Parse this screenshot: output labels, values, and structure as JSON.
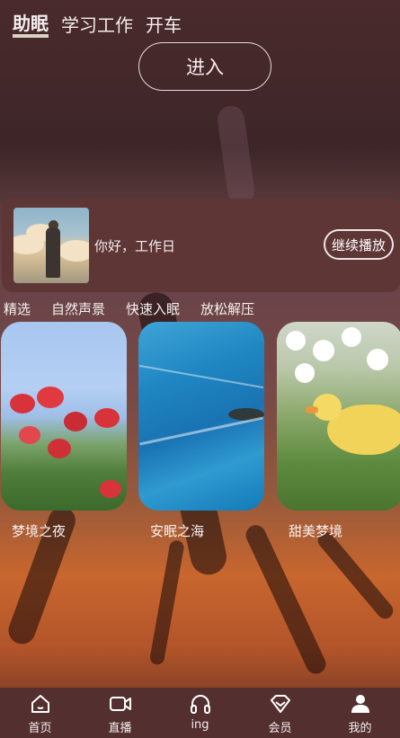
{
  "top_tabs": [
    {
      "label": "助眠",
      "active": true
    },
    {
      "label": "学习工作",
      "active": false
    },
    {
      "label": "开车",
      "active": false
    }
  ],
  "enter_button": "进入",
  "player": {
    "greeting": "你好，工作日",
    "continue_label": "继续播放"
  },
  "categories": [
    "精选",
    "自然声景",
    "快速入眠",
    "放松解压"
  ],
  "cards": [
    {
      "title": "梦境之夜"
    },
    {
      "title": "安眠之海"
    },
    {
      "title": "甜美梦境"
    }
  ],
  "nav": [
    {
      "label": "首页",
      "icon": "home-icon"
    },
    {
      "label": "直播",
      "icon": "video-camera-icon"
    },
    {
      "label": "ing",
      "icon": "headphones-icon"
    },
    {
      "label": "会员",
      "icon": "diamond-icon"
    },
    {
      "label": "我的",
      "icon": "user-icon"
    }
  ],
  "colors": {
    "player_bg": "#5f3636",
    "nav_bg": "#542f2f",
    "active_tab_underline": "#d9d3c0"
  }
}
